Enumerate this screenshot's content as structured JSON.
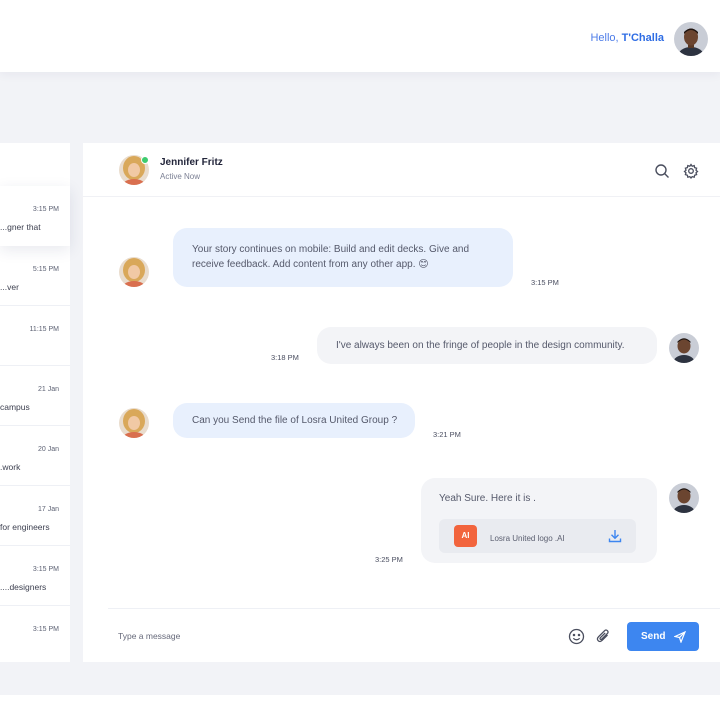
{
  "header": {
    "greeting_prefix": "Hello, ",
    "user_name": "T'Challa"
  },
  "conversations": [
    {
      "time": "3:15 PM",
      "snippet": "gner that...",
      "active": true
    },
    {
      "time": "5:15 PM",
      "snippet": "ver...",
      "active": false
    },
    {
      "time": "11:15 PM",
      "snippet": "",
      "active": false
    },
    {
      "time": "21 Jan",
      "snippet": "campus",
      "active": false
    },
    {
      "time": "20 Jan",
      "snippet": "work.",
      "active": false
    },
    {
      "time": "17 Jan",
      "snippet": "for engineers",
      "active": false
    },
    {
      "time": "3:15 PM",
      "snippet": "designers....",
      "active": false
    },
    {
      "time": "3:15 PM",
      "snippet": "",
      "active": false
    }
  ],
  "chat": {
    "contact_name": "Jennifer Fritz",
    "contact_status": "Active Now",
    "messages": [
      {
        "direction": "incoming",
        "text_line1": "Your story continues on mobile: Build and edit decks. Give and",
        "text_line2": "receive feedback. Add content from any other app. 😊",
        "time": "3:15 PM"
      },
      {
        "direction": "outgoing",
        "text": "I've always been on the fringe of people in the design community.",
        "time": "3:18 PM"
      },
      {
        "direction": "incoming",
        "text": "Can you Send the file of Losra United Group ?",
        "time": "3:21 PM"
      },
      {
        "direction": "outgoing",
        "text": "Yeah Sure. Here it is .",
        "time": "3:25 PM",
        "attachment": {
          "type_badge": "AI",
          "file_name": "Losra United logo .AI"
        }
      }
    ]
  },
  "composer": {
    "placeholder": "Type a message",
    "send_label": "Send"
  },
  "colors": {
    "accent": "#3d86f0",
    "incoming_bubble": "#e8f0fd",
    "outgoing_bubble": "#f3f4f7",
    "online": "#3ecb6f",
    "file_badge": "#f2643d"
  },
  "icons": [
    "search-icon",
    "gear-icon",
    "emoji-icon",
    "paperclip-icon",
    "send-icon",
    "download-icon"
  ]
}
